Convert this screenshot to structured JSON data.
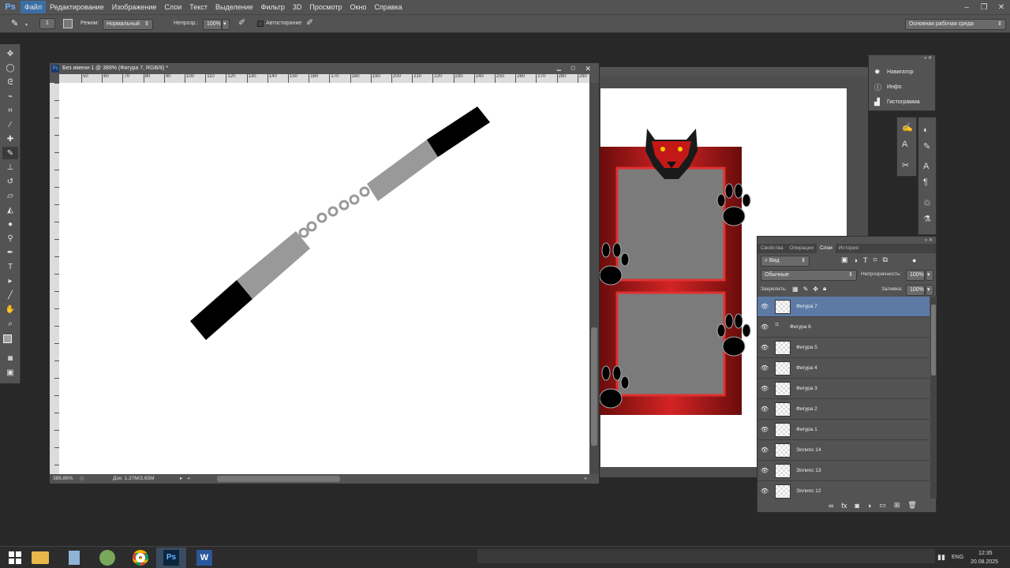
{
  "app": {
    "logo": "Ps"
  },
  "menu": [
    "Файл",
    "Редактирование",
    "Изображение",
    "Слои",
    "Текст",
    "Выделение",
    "Фильтр",
    "3D",
    "Просмотр",
    "Окно",
    "Справка"
  ],
  "options": {
    "brush_size": "1",
    "mode_label": "Режим:",
    "mode_value": "Нормальный",
    "opacity_label": "Непрозр.:",
    "opacity_value": "100%",
    "autoerase_label": "Автостирание",
    "workspace": "Основная рабочая среда"
  },
  "document": {
    "title": "Без имени-1 @ 389% (Фигура 7, RGB/8) *",
    "ruler_ticks": [
      "50",
      "60",
      "70",
      "80",
      "90",
      "100",
      "110",
      "120",
      "130",
      "140",
      "150",
      "160",
      "170",
      "180",
      "190",
      "200",
      "210",
      "220",
      "230",
      "240",
      "250",
      "260",
      "270",
      "280",
      "290",
      "300"
    ],
    "zoom": "388,86%",
    "doc_size": "Док: 1,37M/3,65M"
  },
  "mini_panel": {
    "items": [
      {
        "label": "Навигатор",
        "icon": "navigator-icon"
      },
      {
        "label": "Инфо",
        "icon": "info-icon"
      },
      {
        "label": "Гистограмма",
        "icon": "histogram-icon"
      }
    ]
  },
  "layers_panel": {
    "tabs": [
      "Свойства",
      "Операции",
      "Слои",
      "История"
    ],
    "active_tab": "Слои",
    "filter_kind": "Вид",
    "blend_mode": "Обычные",
    "opacity_label": "Непрозрачность:",
    "opacity_value": "100%",
    "lock_label": "Закрепить:",
    "fill_label": "Заливка:",
    "fill_value": "100%",
    "layers": [
      {
        "name": "Фигура 7",
        "selected": true
      },
      {
        "name": "Фигура 6",
        "selected": false
      },
      {
        "name": "Фигура 5",
        "selected": false
      },
      {
        "name": "Фигура 4",
        "selected": false
      },
      {
        "name": "Фигура 3",
        "selected": false
      },
      {
        "name": "Фигура 2",
        "selected": false
      },
      {
        "name": "Фигура 1",
        "selected": false
      },
      {
        "name": "Эллипс 14",
        "selected": false
      },
      {
        "name": "Эллипс 13",
        "selected": false
      },
      {
        "name": "Эллипс 12",
        "selected": false
      }
    ]
  },
  "taskbar": {
    "lang": "ENG",
    "time": "12:35",
    "date": "20.08.2025",
    "ps_label": "Ps"
  },
  "colors": {
    "accent": "#3b6ea5",
    "frame_red": "#b81c1c",
    "selected_layer": "#5d7aa5"
  }
}
